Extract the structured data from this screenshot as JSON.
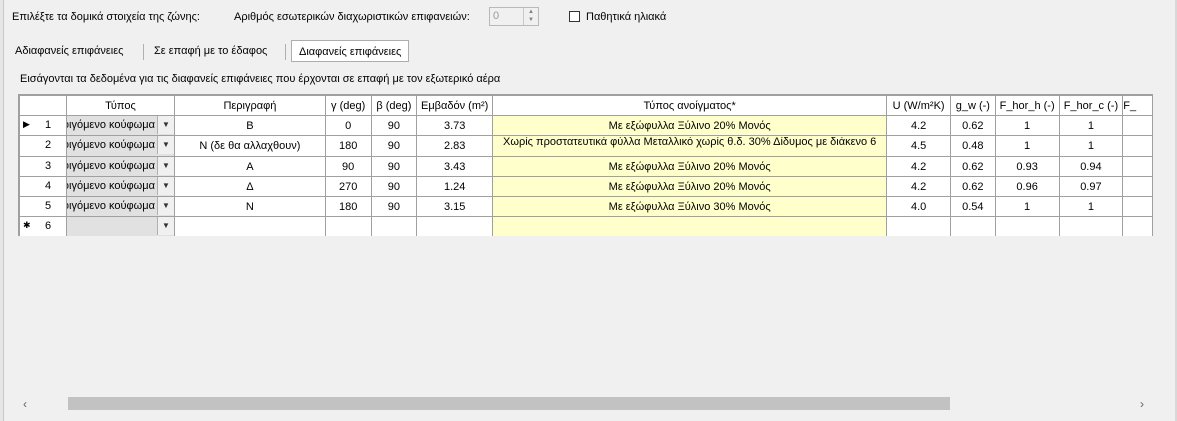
{
  "top": {
    "select_label": "Επιλέξτε τα δομικά στοιχεία της ζώνης:",
    "partitions_label": "Αριθμός εσωτερικών διαχωριστικών επιφανειών:",
    "partitions_value": "0",
    "passive_solar_label": "Παθητικά ηλιακά"
  },
  "tabs": [
    {
      "label": "Αδιαφανείς επιφάνειες"
    },
    {
      "label": "Σε επαφή με το έδαφος"
    },
    {
      "label": "Διαφανείς επιφάνειες"
    }
  ],
  "active_tab": "Διαφανείς επιφάνειες",
  "info_text": "Εισάγονται τα δεδομένα για τις διαφανείς επιφάνειες που έρχονται σε επαφή με τον εξωτερικό αέρα",
  "table": {
    "headers": [
      "Τύπος",
      "Περιγραφή",
      "γ (deg)",
      "β (deg)",
      "Εμβαδόν (m²)",
      "Τύπος ανοίγματος*",
      "U (W/m²K)",
      "g_w (-)",
      "F_hor_h (-)",
      "F_hor_c (-)",
      "F_"
    ],
    "rows": [
      {
        "num": "1",
        "marker": "▶",
        "type": "Διαφανές δομικό στοιχείο - ανοιγόμενο κούφωμα",
        "desc": "Β",
        "gamma": "0",
        "beta": "90",
        "area": "3.73",
        "opening": "Με εξώφυλλα Ξύλινο 20% Μονός",
        "u": "4.2",
        "gw": "0.62",
        "fh": "1",
        "fc": "1"
      },
      {
        "num": "2",
        "marker": "",
        "type": "Διαφανές δομικό στοιχείο - ανοιγόμενο κούφωμα",
        "desc": "Ν (δε θα αλλαχθουν)",
        "gamma": "180",
        "beta": "90",
        "area": "2.83",
        "opening": "Χωρίς προστατευτικά φύλλα Μεταλλικό χωρίς θ.δ. 30% Δίδυμος με διάκενο 6",
        "u": "4.5",
        "gw": "0.48",
        "fh": "1",
        "fc": "1"
      },
      {
        "num": "3",
        "marker": "",
        "type": "Διαφανές δομικό στοιχείο - ανοιγόμενο κούφωμα",
        "desc": "Α",
        "gamma": "90",
        "beta": "90",
        "area": "3.43",
        "opening": "Με εξώφυλλα Ξύλινο 20% Μονός",
        "u": "4.2",
        "gw": "0.62",
        "fh": "0.93",
        "fc": "0.94"
      },
      {
        "num": "4",
        "marker": "",
        "type": "Διαφανές δομικό στοιχείο - ανοιγόμενο κούφωμα",
        "desc": "Δ",
        "gamma": "270",
        "beta": "90",
        "area": "1.24",
        "opening": "Με εξώφυλλα Ξύλινο 20% Μονός",
        "u": "4.2",
        "gw": "0.62",
        "fh": "0.96",
        "fc": "0.97"
      },
      {
        "num": "5",
        "marker": "",
        "type": "Διαφανές δομικό στοιχείο - ανοιγόμενο κούφωμα",
        "desc": "Ν",
        "gamma": "180",
        "beta": "90",
        "area": "3.15",
        "opening": "Με εξώφυλλα Ξύλινο 30% Μονός",
        "u": "4.0",
        "gw": "0.54",
        "fh": "1",
        "fc": "1"
      }
    ],
    "new_row": {
      "num": "6",
      "marker": "✱"
    }
  },
  "scrollbar": {
    "left_arrow": "‹",
    "right_arrow": "›"
  }
}
